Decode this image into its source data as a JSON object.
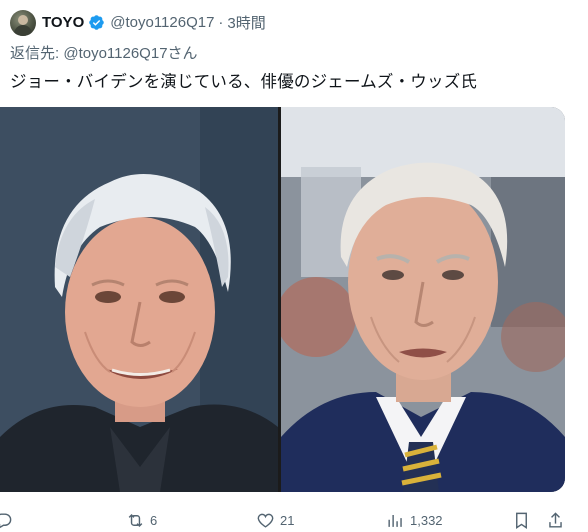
{
  "tweet": {
    "display_name": "TOYO",
    "handle": "@toyo1126Q17",
    "separator": "·",
    "time": "3時間",
    "reply_to_prefix": "返信先:",
    "reply_to_handle": "@toyo1126Q17さん",
    "text": "ジョー・バイデンを演じている、俳優のジェームズ・ウッズ氏"
  },
  "media": {
    "images": [
      "james-woods-photo",
      "joe-biden-photo"
    ]
  },
  "actions": {
    "retweets": "6",
    "likes": "21",
    "views": "1,332"
  },
  "colors": {
    "verified": "#1d9bf0",
    "secondary_text": "#536471",
    "primary_text": "#0f1419"
  }
}
